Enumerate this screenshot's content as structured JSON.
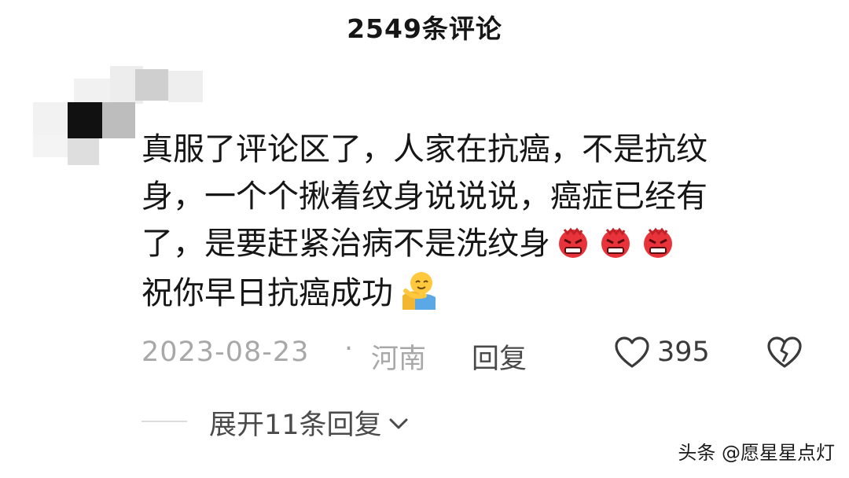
{
  "header": {
    "title": "2549条评论"
  },
  "comment": {
    "lines": [
      "真服了评论区了，人家在抗癌，不是抗纹",
      "身，一个个揪着纹身说说说，癌症已经有",
      "了，是要赶紧治病不是洗纹身",
      "祝你早日抗癌成功"
    ],
    "angry_emoji_count": 3,
    "hug_emoji_count": 1,
    "date": "2023-08-23",
    "separator": "·",
    "location": "河南",
    "reply_label": "回复",
    "like_count": "395",
    "expand_label": "展开11条回复"
  },
  "watermark": {
    "text": "头条 @愿星星点灯"
  },
  "icons": {
    "like": "heart-outline-icon",
    "dislike": "broken-heart-icon",
    "expand": "chevron-down-icon",
    "emoji_angry": "angry-face-emoji",
    "emoji_hug": "hugging-face-emoji"
  },
  "colors": {
    "text_primary": "#161616",
    "text_meta": "#a8a8a8",
    "text_action": "#4a4a4a",
    "angry_red": "#e8333a"
  }
}
